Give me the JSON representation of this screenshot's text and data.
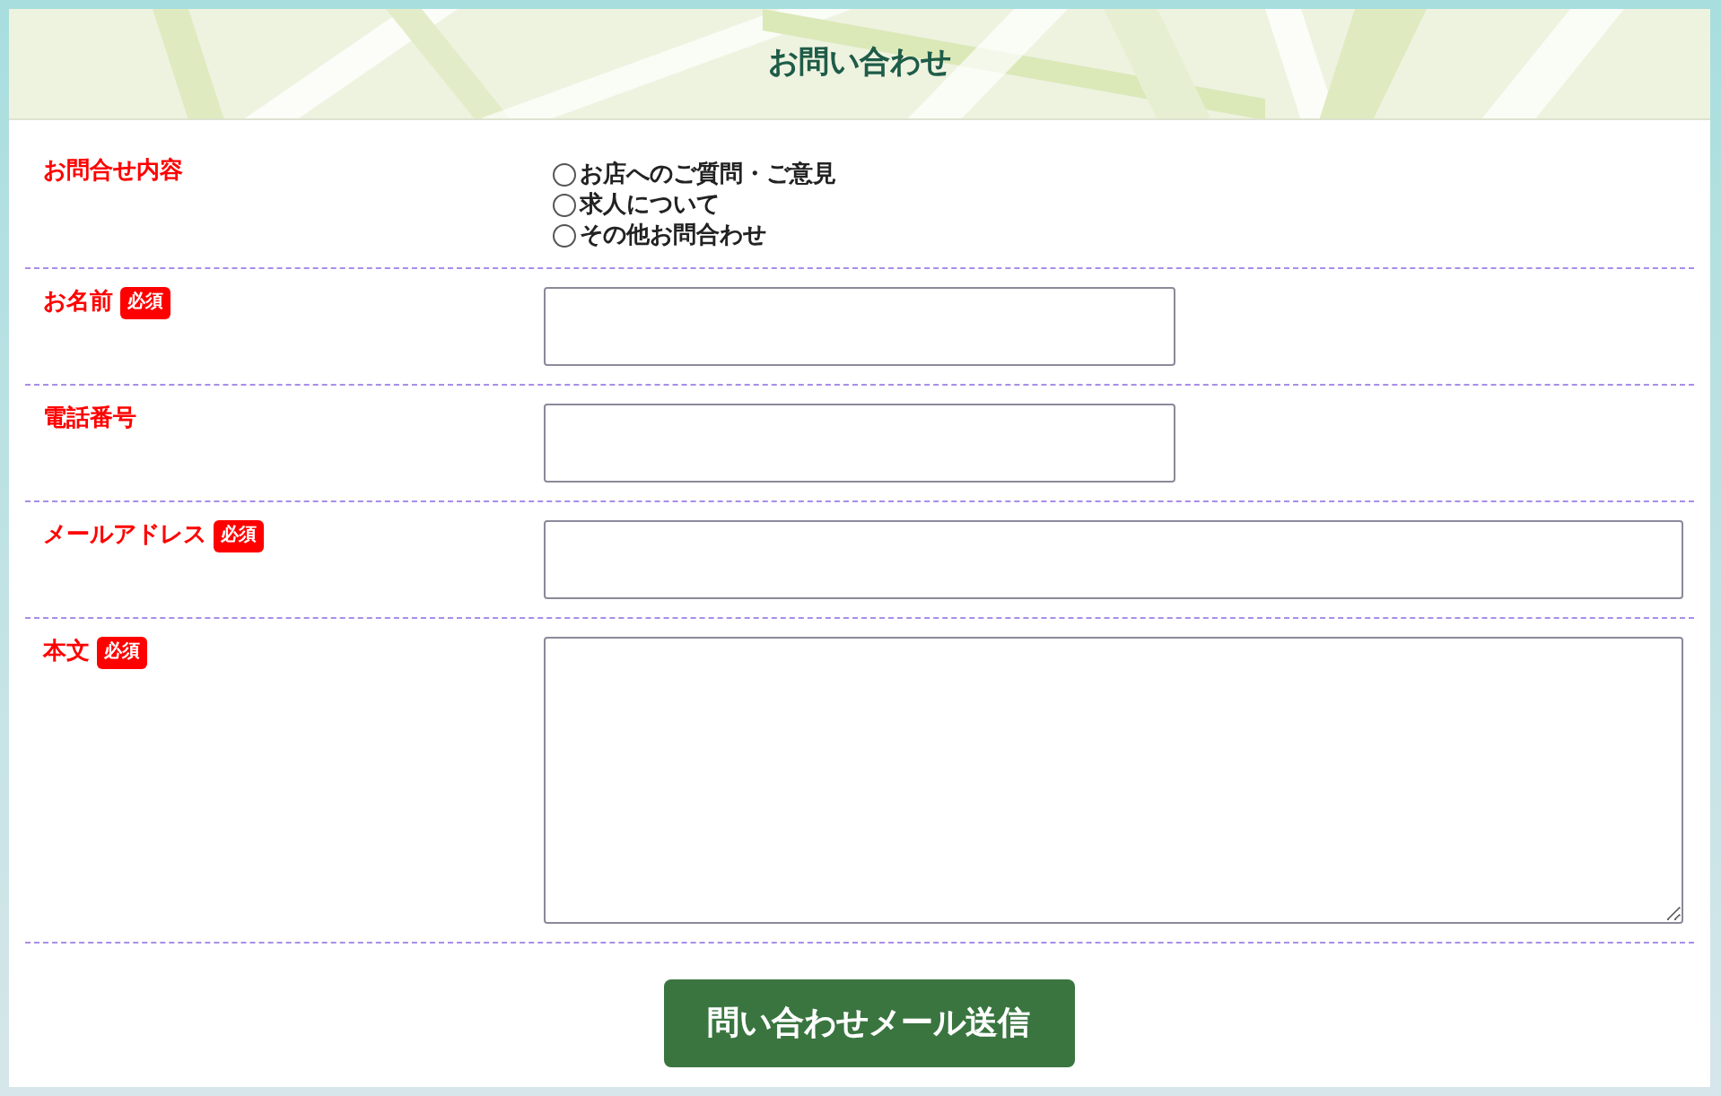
{
  "header": {
    "title": "お問い合わせ"
  },
  "rows": [
    {
      "kind": "radio",
      "label": "お問合せ内容",
      "options": [
        {
          "label": "お店へのご質問・ご意見",
          "selected": false
        },
        {
          "label": "求人について",
          "selected": false
        },
        {
          "label": "その他お問合わせ",
          "selected": false
        }
      ]
    },
    {
      "kind": "short",
      "label": "お名前",
      "badge": "必須"
    },
    {
      "kind": "short",
      "label": "電話番号"
    },
    {
      "kind": "full",
      "label": "メールアドレス",
      "badge": "必須"
    },
    {
      "kind": "textarea",
      "label": "本文",
      "badge": "必須"
    }
  ],
  "submit": {
    "label": "問い合わせメール送信"
  }
}
